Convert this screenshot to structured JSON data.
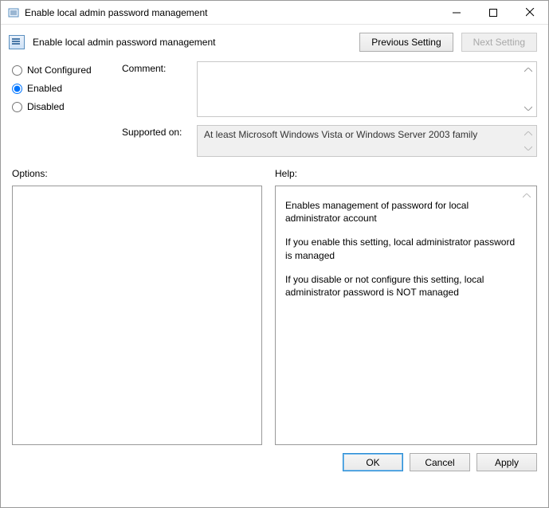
{
  "titlebar": {
    "title": "Enable local admin password management"
  },
  "header": {
    "title": "Enable local admin password management",
    "previous_label": "Previous Setting",
    "next_label": "Next Setting"
  },
  "radios": {
    "not_configured": "Not Configured",
    "enabled": "Enabled",
    "disabled": "Disabled",
    "selected": "enabled"
  },
  "fields": {
    "comment_label": "Comment:",
    "comment_value": "",
    "supported_label": "Supported on:",
    "supported_value": "At least Microsoft Windows Vista or Windows Server 2003 family"
  },
  "columns": {
    "options_label": "Options:",
    "help_label": "Help:"
  },
  "help": {
    "p1": "Enables management of password for local administrator account",
    "p2": "If you enable this setting, local administrator password is managed",
    "p3": "If you disable or not configure this setting, local administrator password is NOT managed"
  },
  "footer": {
    "ok": "OK",
    "cancel": "Cancel",
    "apply": "Apply"
  }
}
